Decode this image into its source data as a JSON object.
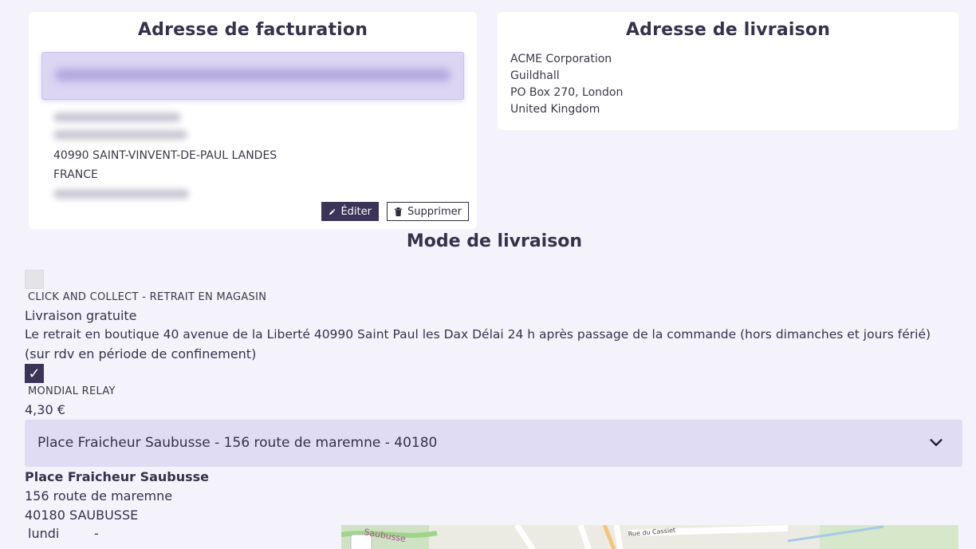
{
  "billing": {
    "title": "Adresse de facturation",
    "city_line": "40990 SAINT-VINVENT-DE-PAUL LANDES",
    "country": "FRANCE",
    "edit_label": "Éditer",
    "delete_label": "Supprimer"
  },
  "shipping": {
    "title": "Adresse de livraison",
    "lines": [
      "ACME Corporation",
      "Guildhall",
      "PO Box 270, London",
      "United Kingdom"
    ]
  },
  "delivery": {
    "title": "Mode de livraison",
    "options": [
      {
        "name": "CLICK AND COLLECT - RETRAIT EN MAGASIN",
        "price": "Livraison gratuite",
        "description_1": "Le retrait en boutique 40 avenue de la Liberté 40990 Saint Paul les Dax Délai 24 h après passage de la commande (hors dimanches et jours férié)",
        "description_2": "(sur rdv en période de confinement)",
        "checked": false
      },
      {
        "name": "MONDIAL RELAY",
        "price": "4,30 €",
        "checked": true,
        "check_glyph": "✓"
      }
    ],
    "relay_select": {
      "value": "Place Fraicheur Saubusse - 156 route de maremne - 40180"
    },
    "relay": {
      "name": "Place Fraicheur Saubusse",
      "street": "156 route de maremne",
      "city": "40180 SAUBUSSE",
      "hours_day": "lundi",
      "hours_value": "-"
    },
    "map": {
      "labels": [
        "Saubusse",
        "Rue du Cassiet"
      ]
    }
  },
  "colors": {
    "accent": "#3b3458",
    "background": "#f4f3fb",
    "select_bg": "#e0dcf4"
  }
}
